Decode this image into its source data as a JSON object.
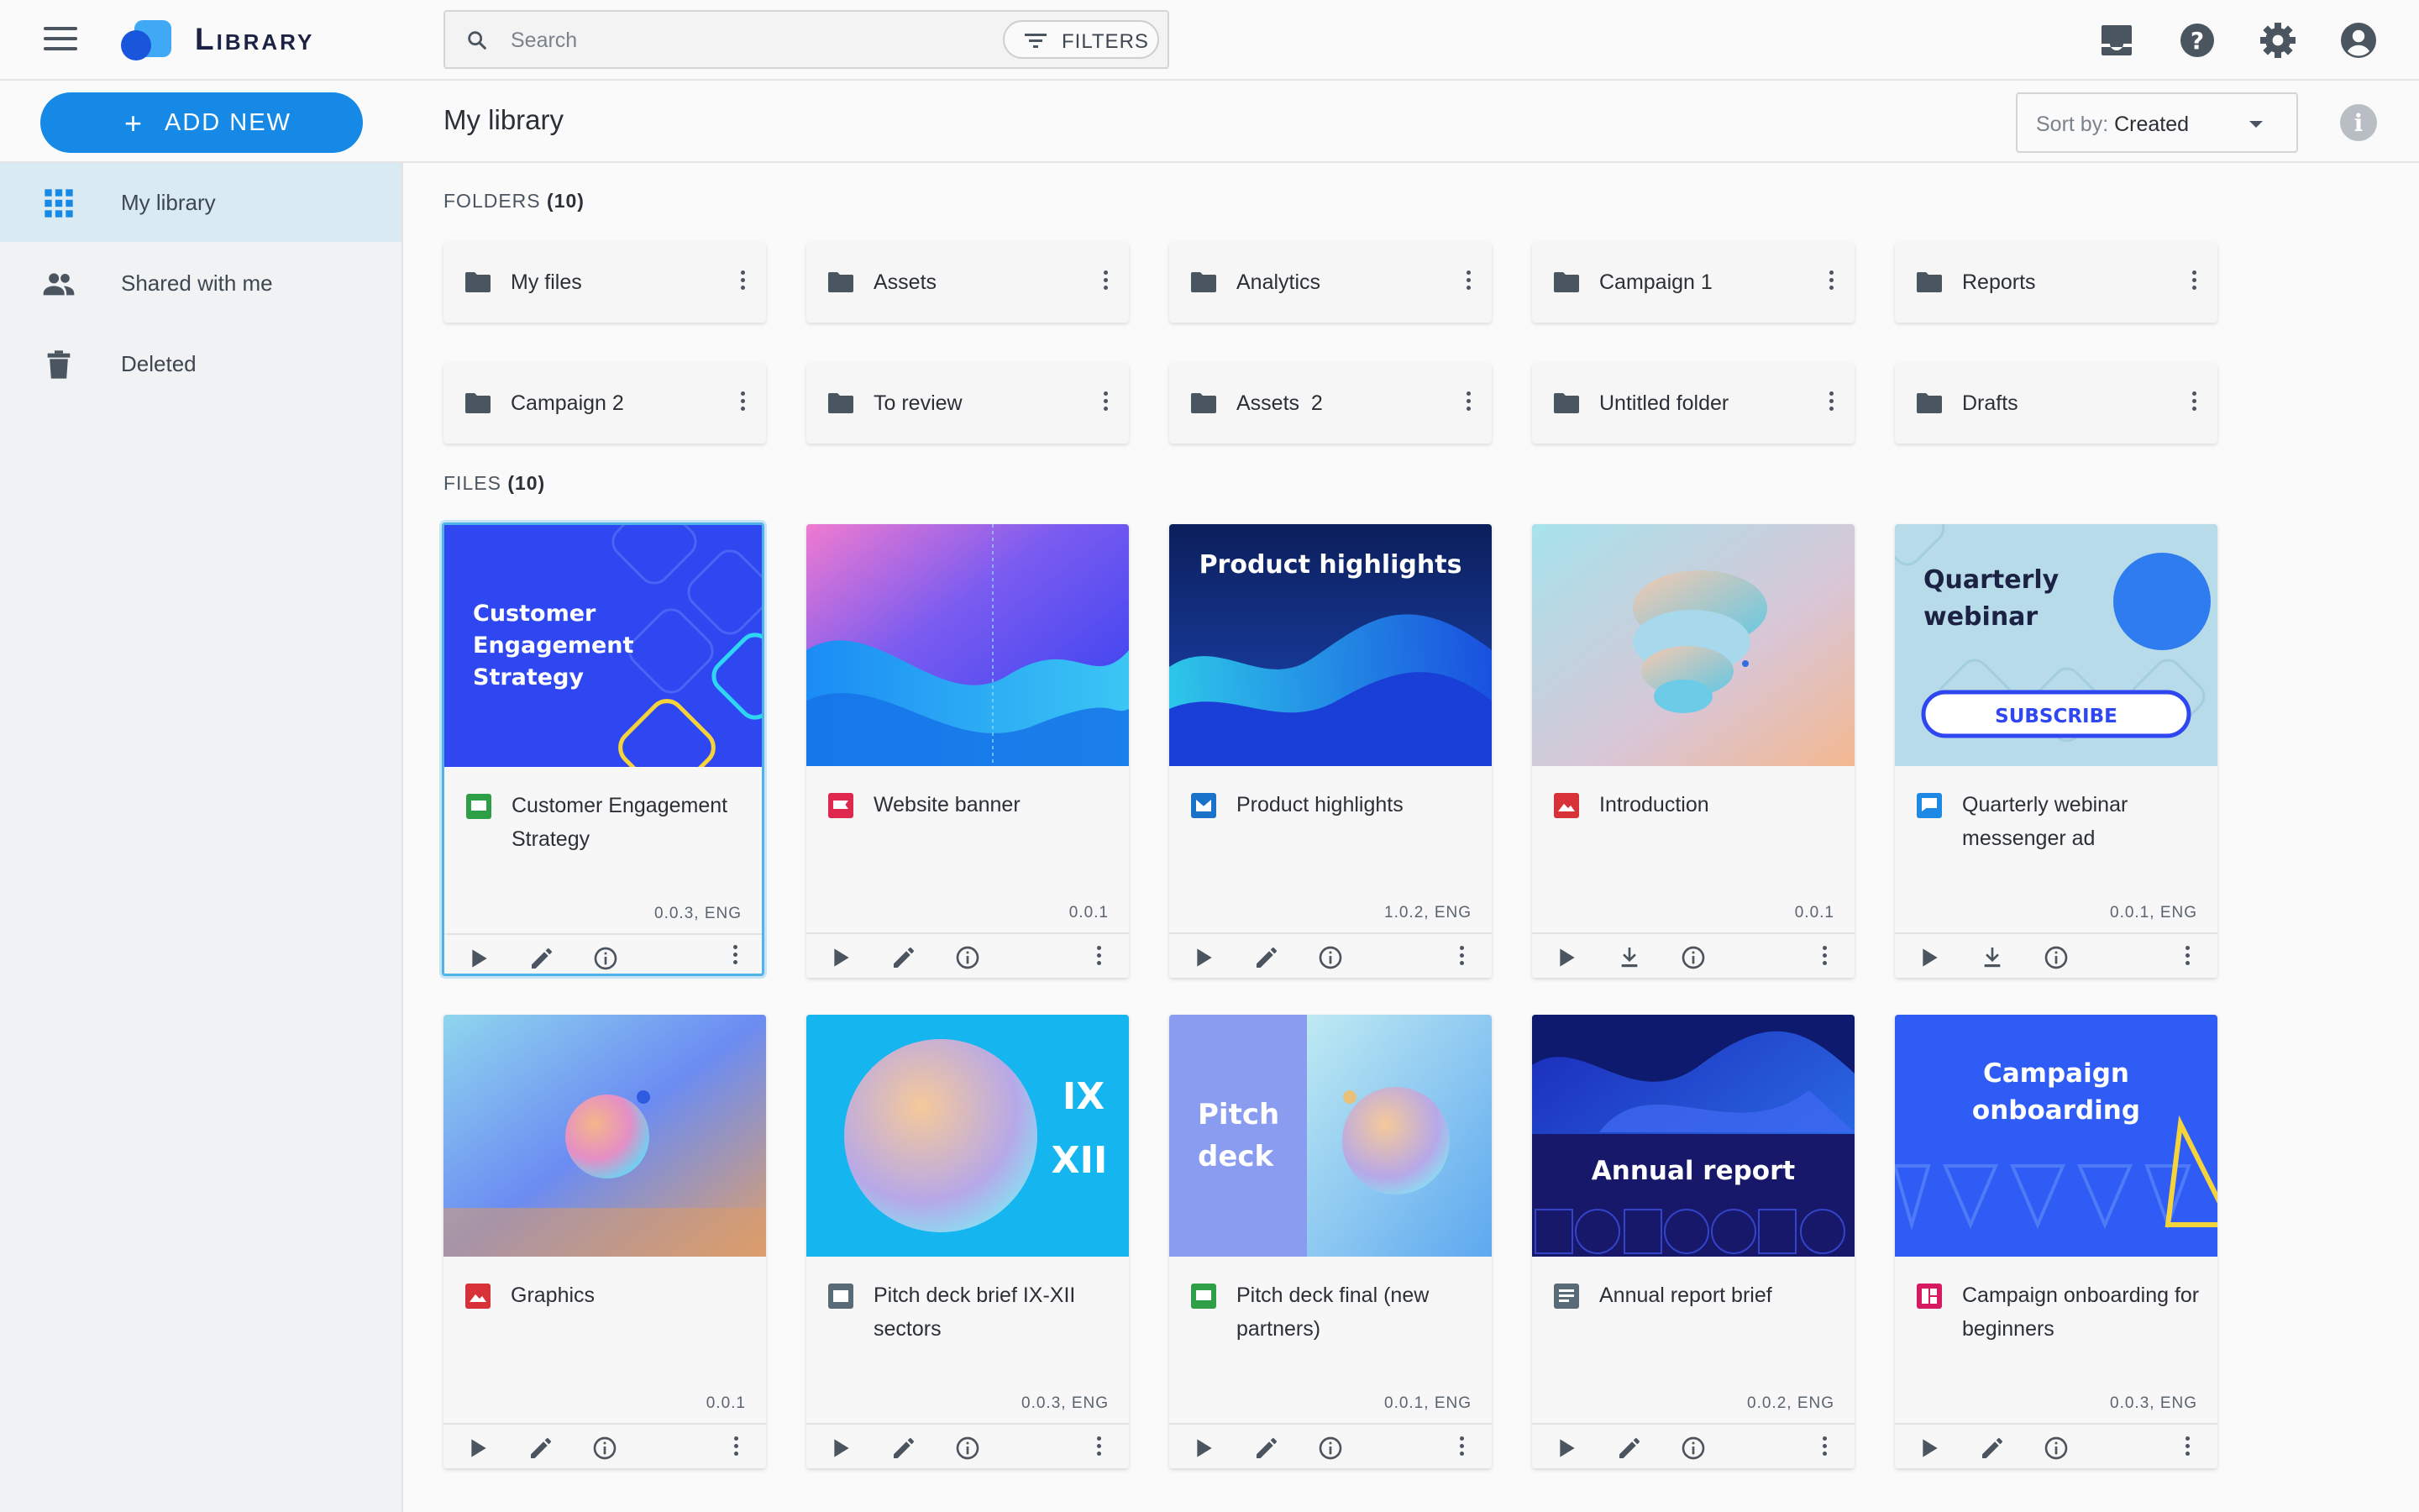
{
  "app": {
    "title": "Library"
  },
  "search": {
    "placeholder": "Search",
    "filters_label": "FILTERS"
  },
  "toolbar": {
    "add_new_label": "ADD NEW",
    "page_title": "My library",
    "sort_prefix": "Sort by: ",
    "sort_value": "Created"
  },
  "sidebar": {
    "items": [
      {
        "label": "My library",
        "icon": "grid-icon",
        "active": true
      },
      {
        "label": "Shared with me",
        "icon": "people-icon",
        "active": false
      },
      {
        "label": "Deleted",
        "icon": "trash-icon",
        "active": false
      }
    ]
  },
  "folders_section": {
    "label": "FOLDERS",
    "count": "(10)"
  },
  "folders": [
    {
      "name": "My files"
    },
    {
      "name": "Assets"
    },
    {
      "name": "Analytics"
    },
    {
      "name": "Campaign 1"
    },
    {
      "name": "Reports"
    },
    {
      "name": "Campaign 2"
    },
    {
      "name": "To review"
    },
    {
      "name": "Assets  2"
    },
    {
      "name": "Untitled folder"
    },
    {
      "name": "Drafts"
    }
  ],
  "files_section": {
    "label": "FILES",
    "count": "(10)"
  },
  "files": [
    {
      "title": "Customer Engagement Strategy",
      "version": "0.0.3, ENG",
      "type_color": "#2e9e47",
      "thumb_text": "Customer Engagement Strategy",
      "second_action": "edit-icon"
    },
    {
      "title": "Website banner",
      "version": "0.0.1",
      "type_color": "#e0284f",
      "thumb_text": "",
      "second_action": "edit-icon"
    },
    {
      "title": "Product highlights",
      "version": "1.0.2, ENG",
      "type_color": "#1a73c8",
      "thumb_text": "Product highlights",
      "second_action": "edit-icon"
    },
    {
      "title": "Introduction",
      "version": "0.0.1",
      "type_color": "#d7323a",
      "thumb_text": "",
      "second_action": "download-icon"
    },
    {
      "title": "Quarterly webinar messenger ad",
      "version": "0.0.1, ENG",
      "type_color": "#1e88e5",
      "thumb_text": "Quarterly webinar",
      "thumb_button": "SUBSCRIBE",
      "second_action": "download-icon"
    },
    {
      "title": "Graphics",
      "version": "0.0.1",
      "type_color": "#d7323a",
      "thumb_text": "",
      "second_action": "edit-icon"
    },
    {
      "title": "Pitch deck brief IX-XII sectors",
      "version": "0.0.3, ENG",
      "type_color": "#5a6b78",
      "thumb_text": "IX XII",
      "second_action": "edit-icon"
    },
    {
      "title": "Pitch deck final (new partners)",
      "version": "0.0.1, ENG",
      "type_color": "#2e9e47",
      "thumb_text": "Pitch deck",
      "second_action": "edit-icon"
    },
    {
      "title": "Annual report brief",
      "version": "0.0.2, ENG",
      "type_color": "#5a6b78",
      "thumb_text": "Annual report",
      "second_action": "edit-icon"
    },
    {
      "title": "Campaign onboarding for beginners",
      "version": "0.0.3, ENG",
      "type_color": "#d81b60",
      "thumb_text": "Campaign onboarding",
      "second_action": "edit-icon"
    }
  ],
  "colors": {
    "accent": "#1689e6",
    "selected_border": "#4fb3ea"
  }
}
